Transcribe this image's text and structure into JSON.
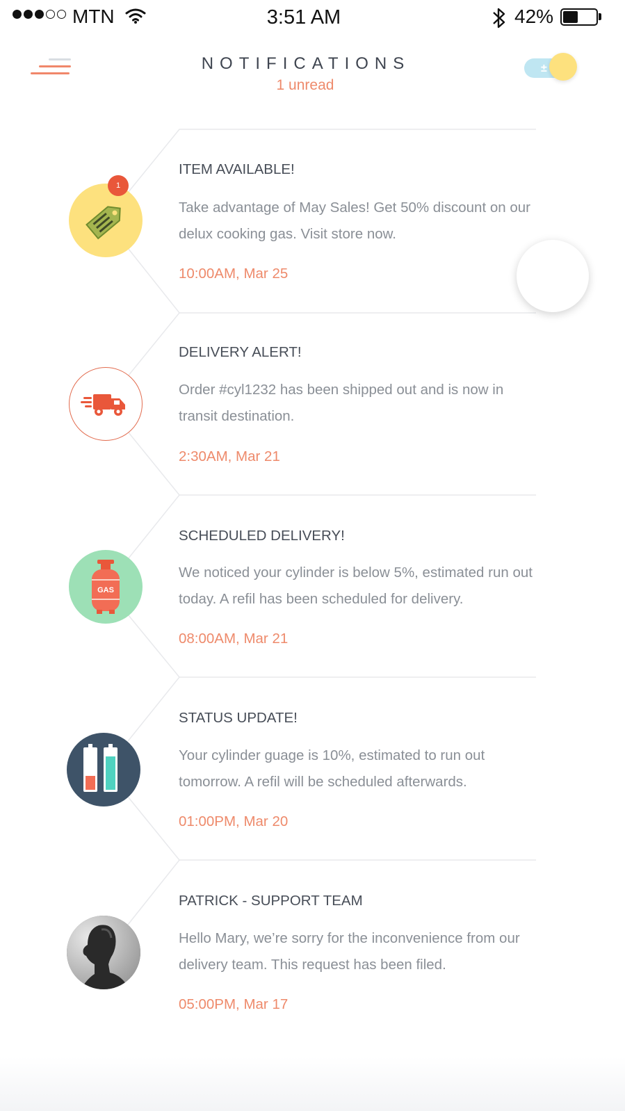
{
  "status_bar": {
    "carrier": "MTN",
    "time": "3:51 AM",
    "battery": "42%",
    "battery_level": 0.42,
    "signal_bars": 3,
    "icons": [
      "signal-icon",
      "wifi-icon",
      "bluetooth-icon",
      "battery-icon"
    ]
  },
  "header": {
    "title": "NOTIFICATIONS",
    "unread": "1 unread",
    "menu_icon": "menu-icon",
    "toggle_icon": "toggle-icon"
  },
  "colors": {
    "accent": "#ee8a6b",
    "badge": "#e9573a",
    "title_text": "#474d57",
    "body_text": "#8a8f96"
  },
  "notifications": [
    {
      "title": "ITEM AVAILABLE!",
      "body": "Take advantage of May Sales! Get 50% discount on our delux cooking gas. Visit store now.",
      "time": "10:00AM, Mar 25",
      "icon": "price-tag-icon",
      "badge": "1"
    },
    {
      "title": "DELIVERY ALERT!",
      "body": "Order #cyl1232 has been shipped out and is now in transit destination.",
      "time": "2:30AM, Mar 21",
      "icon": "delivery-truck-icon"
    },
    {
      "title": "SCHEDULED DELIVERY!",
      "body": "We noticed your cylinder is below 5%, estimated run out today. A refil has been scheduled for delivery.",
      "time": "08:00AM, Mar 21",
      "icon": "gas-cylinder-icon",
      "icon_label": "GAS"
    },
    {
      "title": "STATUS UPDATE!",
      "body": "Your cylinder guage is 10%, estimated to run out tomorrow. A refil will be scheduled afterwards.",
      "time": "01:00PM, Mar 20",
      "icon": "battery-gauge-icon"
    },
    {
      "title": "PATRICK - SUPPORT TEAM",
      "body": "Hello Mary, we’re sorry for the inconvenience from our delivery team. This request has been filed.",
      "time": "05:00PM, Mar 17",
      "icon": "avatar"
    }
  ]
}
